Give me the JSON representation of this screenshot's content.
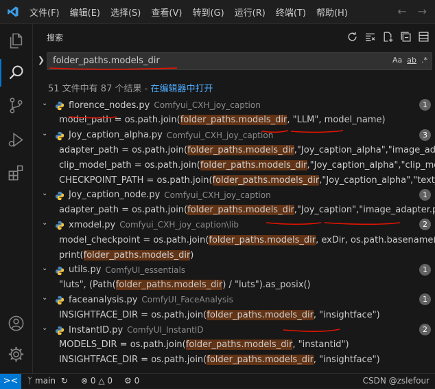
{
  "titlebar": {
    "menu": [
      "文件(F)",
      "编辑(E)",
      "选择(S)",
      "查看(V)",
      "转到(G)",
      "运行(R)",
      "终端(T)",
      "帮助(H)"
    ]
  },
  "sidebar": {
    "title": "搜索",
    "search": {
      "value": "folder_paths.models_dir"
    },
    "options": {
      "case": "Aa",
      "word": "ab",
      "regex": ".*"
    },
    "summary": {
      "text": "51 文件中有 87 个结果 - ",
      "link": "在编辑器中打开"
    }
  },
  "results": [
    {
      "kind": "file",
      "name": "florence_nodes.py",
      "path": "Comfyui_CXH_joy_caption",
      "count": "1"
    },
    {
      "kind": "match",
      "parts": [
        {
          "t": "model_path = os.path.join("
        },
        {
          "t": "folder_paths.models_dir",
          "h": true
        },
        {
          "t": ", \"LLM\", model_name)"
        }
      ]
    },
    {
      "kind": "file",
      "name": "Joy_caption_alpha.py",
      "path": "Comfyui_CXH_joy_caption",
      "count": "3"
    },
    {
      "kind": "match",
      "parts": [
        {
          "t": "adapter_path =  os.path.join("
        },
        {
          "t": "folder_paths.models_dir",
          "h": true
        },
        {
          "t": ",\"Joy_caption_alpha\",\"image_adapter.pt\")"
        }
      ]
    },
    {
      "kind": "match",
      "parts": [
        {
          "t": "clip_model_path = os.path.join("
        },
        {
          "t": "folder_paths.models_dir",
          "h": true
        },
        {
          "t": ",\"Joy_caption_alpha\",\"clip_model.pt\")"
        }
      ]
    },
    {
      "kind": "match",
      "parts": [
        {
          "t": "CHECKPOINT_PATH = os.path.join("
        },
        {
          "t": "folder_paths.models_dir",
          "h": true
        },
        {
          "t": ",\"Joy_caption_alpha\",\"text_model\")"
        }
      ]
    },
    {
      "kind": "file",
      "name": "Joy_caption_node.py",
      "path": "Comfyui_CXH_joy_caption",
      "count": "1"
    },
    {
      "kind": "match",
      "parts": [
        {
          "t": "adapter_path =  os.path.join("
        },
        {
          "t": "folder_paths.models_dir",
          "h": true
        },
        {
          "t": ",\"Joy_caption\",\"image_adapter.pt\")"
        }
      ]
    },
    {
      "kind": "file",
      "name": "xmodel.py",
      "path": "Comfyui_CXH_joy_caption\\lib",
      "count": "2"
    },
    {
      "kind": "match",
      "parts": [
        {
          "t": "model_checkpoint = os.path.join("
        },
        {
          "t": "folder_paths.models_dir",
          "h": true
        },
        {
          "t": ", exDir, os.path.basename(model_id))"
        }
      ]
    },
    {
      "kind": "match",
      "parts": [
        {
          "t": "print("
        },
        {
          "t": "folder_paths.models_dir",
          "h": true
        },
        {
          "t": ")"
        }
      ]
    },
    {
      "kind": "file",
      "name": "utils.py",
      "path": "ComfyUI_essentials",
      "count": "1"
    },
    {
      "kind": "match",
      "parts": [
        {
          "t": "\"luts\", (Path("
        },
        {
          "t": "folder_paths.models_dir",
          "h": true
        },
        {
          "t": ") / \"luts\").as_posix()"
        }
      ]
    },
    {
      "kind": "file",
      "name": "faceanalysis.py",
      "path": "ComfyUI_FaceAnalysis",
      "count": "1"
    },
    {
      "kind": "match",
      "parts": [
        {
          "t": "INSIGHTFACE_DIR = os.path.join("
        },
        {
          "t": "folder_paths.models_dir",
          "h": true
        },
        {
          "t": ", \"insightface\")"
        }
      ]
    },
    {
      "kind": "file",
      "name": "InstantID.py",
      "path": "ComfyUI_InstantID",
      "count": "2"
    },
    {
      "kind": "match",
      "parts": [
        {
          "t": "MODELS_DIR = os.path.join("
        },
        {
          "t": "folder_paths.models_dir",
          "h": true
        },
        {
          "t": ", \"instantid\")"
        }
      ]
    },
    {
      "kind": "match",
      "parts": [
        {
          "t": "INSIGHTFACE_DIR = os.path.join("
        },
        {
          "t": "folder_paths.models_dir",
          "h": true
        },
        {
          "t": ", \"insightface\")"
        }
      ]
    }
  ],
  "statusbar": {
    "remote": "><",
    "branch": "main",
    "errors": "0",
    "warnings": "0",
    "ports": "0",
    "watermark": "CSDN @zslefour"
  },
  "colors": {
    "accent": "#0078d4",
    "match_highlight": "#623315",
    "annotation_red": "#e51400",
    "link": "#4daafc"
  }
}
